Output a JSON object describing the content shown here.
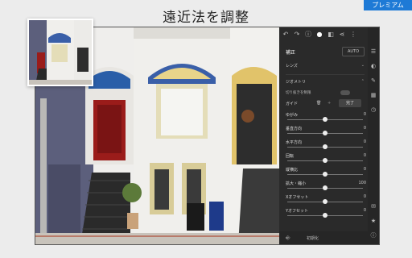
{
  "heading": "遠近法を調整",
  "premium_badge": "プレミアム",
  "panel": {
    "title": "補正",
    "auto_label": "AUTO",
    "lens_label": "レンズ",
    "geometry_label": "ジオメトリ",
    "crop_label": "切り抜きを制限",
    "guide_label": "ガイド",
    "done_label": "完了",
    "reset_label": "初期化",
    "sliders": [
      {
        "label": "ゆがみ",
        "value": "0",
        "level": 0.5
      },
      {
        "label": "垂直方向",
        "value": "0",
        "level": 0.5
      },
      {
        "label": "水平方向",
        "value": "0",
        "level": 0.5
      },
      {
        "label": "回転",
        "value": "0",
        "level": 0.5
      },
      {
        "label": "縦横比",
        "value": "0",
        "level": 0.5
      },
      {
        "label": "拡大・縮小",
        "value": "100",
        "level": 0.5
      },
      {
        "label": "Xオフセット",
        "value": "0",
        "level": 0.5
      },
      {
        "label": "Yオフセット",
        "value": "0",
        "level": 0.5
      }
    ]
  },
  "colors": {
    "accent": "#1e7ad6",
    "panel_bg": "#2a2a2a",
    "brick": "#5a5e78",
    "door_red": "#9a1c1a"
  },
  "icons": {
    "topbar": [
      "undo-icon",
      "redo-icon",
      "info-icon",
      "edit-active-icon",
      "compare-icon",
      "share-icon",
      "more-icon"
    ],
    "sidebar": [
      "presets-icon",
      "adjust-icon",
      "brush-icon",
      "detail-icon",
      "history-icon",
      "comment-icon",
      "star-icon",
      "info-icon"
    ]
  }
}
